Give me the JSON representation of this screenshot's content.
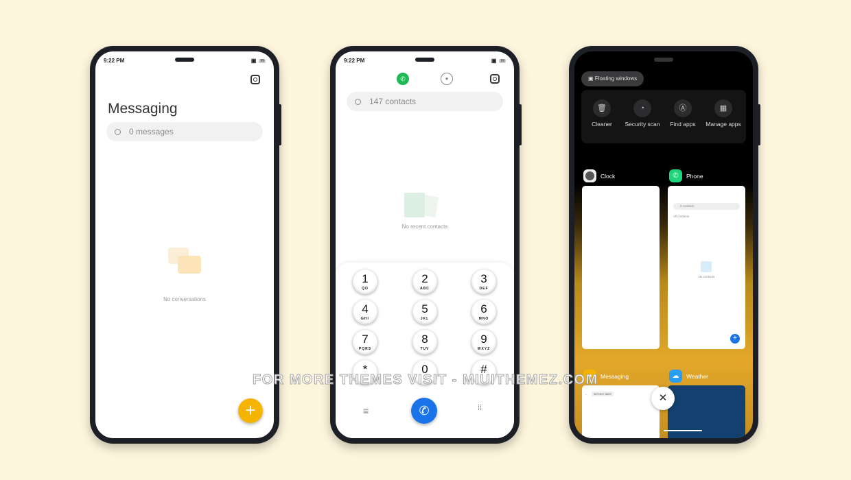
{
  "status": {
    "time": "9:22 PM",
    "battery": "99"
  },
  "messaging": {
    "title": "Messaging",
    "search_placeholder": "0 messages",
    "empty": "No conversations",
    "fab_icon": "plus-icon",
    "accent": "#f5b400"
  },
  "phone": {
    "search_placeholder": "147 contacts",
    "empty": "No recent contacts",
    "accent": "#1a73e8",
    "tab_active": "#1db954",
    "keys": [
      {
        "d": "1",
        "l": "QO"
      },
      {
        "d": "2",
        "l": "ABC"
      },
      {
        "d": "3",
        "l": "DEF"
      },
      {
        "d": "4",
        "l": "GHI"
      },
      {
        "d": "5",
        "l": "JKL"
      },
      {
        "d": "6",
        "l": "MNO"
      },
      {
        "d": "7",
        "l": "PQRS"
      },
      {
        "d": "8",
        "l": "TUV"
      },
      {
        "d": "9",
        "l": "WXYZ"
      },
      {
        "d": "*",
        "l": ""
      },
      {
        "d": "0",
        "l": "+"
      },
      {
        "d": "#",
        "l": ""
      }
    ]
  },
  "recents": {
    "floating": "Floating windows",
    "tools": [
      {
        "label": "Cleaner",
        "icon": "trash-icon"
      },
      {
        "label": "Security scan",
        "icon": "gauge-icon"
      },
      {
        "label": "Find apps",
        "icon": "find-apps-icon"
      },
      {
        "label": "Manage apps",
        "icon": "grid-icon"
      }
    ],
    "cards": [
      {
        "name": "Clock"
      },
      {
        "name": "Phone"
      },
      {
        "name": "Messaging"
      },
      {
        "name": "Weather"
      }
    ],
    "phone_card": {
      "search": "0 contacts",
      "filter": "All contacts",
      "empty": "No contacts"
    },
    "messaging_card": {
      "number": "9870027 8809"
    },
    "close_icon": "close-icon"
  },
  "watermark": "FOR MORE THEMES VISIT - MIUITHEMEZ.COM"
}
